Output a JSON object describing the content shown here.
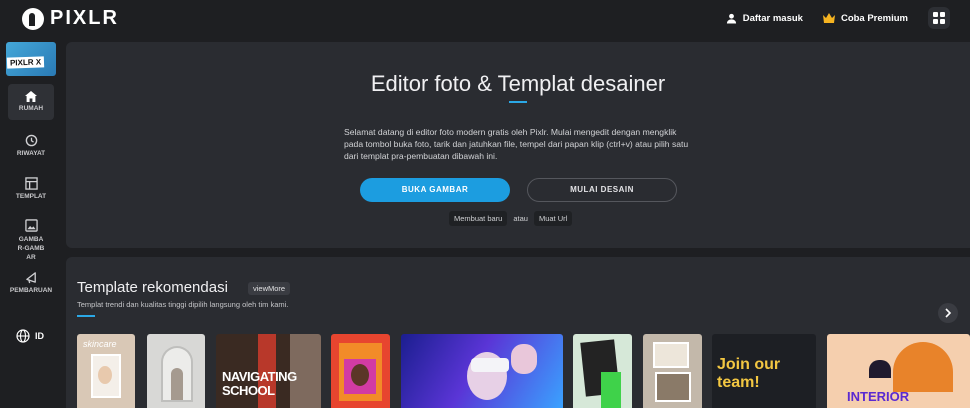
{
  "header": {
    "logo_text": "PIXLR",
    "login_label": "Daftar masuk",
    "premium_label": "Coba Premium"
  },
  "sidebar": {
    "badge": "PIXLR X",
    "items": [
      {
        "label": "RUMAH",
        "icon": "home-icon"
      },
      {
        "label": "RIWAYAT",
        "icon": "history-icon"
      },
      {
        "label": "TEMPLAT",
        "icon": "template-icon"
      },
      {
        "label": "GAMBAR-GAMBAR",
        "icon": "image-icon"
      },
      {
        "label": "PEMBARUAN",
        "icon": "megaphone-icon"
      }
    ],
    "language": "ID"
  },
  "hero": {
    "title": "Editor foto & Templat desainer",
    "description": "Selamat datang di editor foto modern gratis oleh Pixlr. Mulai mengedit dengan mengklik pada tombol buka foto, tarik dan jatuhkan file, tempel dari papan klip (ctrl+v) atau pilih satu dari templat pra-pembuatan dibawah ini.",
    "open_button": "BUKA GAMBAR",
    "design_button": "MULAI DESAIN",
    "new_chip": "Membuat baru",
    "or_text": "atau",
    "url_chip": "Muat Url"
  },
  "recommendations": {
    "title": "Template rekomendasi",
    "view_more": "viewMore",
    "subtitle": "Templat trendi dan kualitas tinggi dipilih langsung oleh tim kami.",
    "thumbs": [
      {
        "text": "skincare"
      },
      {
        "text": ""
      },
      {
        "text": "NAVIGATING SCHOOL"
      },
      {
        "text": ""
      },
      {
        "text": ""
      },
      {
        "text": ""
      },
      {
        "text": ""
      },
      {
        "text": "Join our team!"
      },
      {
        "text": "INTERIOR"
      }
    ]
  },
  "colors": {
    "accent": "#1c9de0",
    "background": "#1e1f22",
    "panel": "#2a2c31"
  }
}
